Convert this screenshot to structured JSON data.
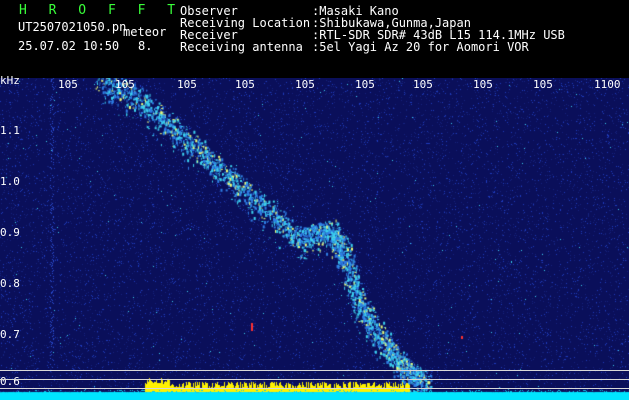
{
  "header": {
    "station": "H R O F F T",
    "filename": "UT2507021050.pn",
    "type": "meteor",
    "datetime": "25.07.02 10:50",
    "count": "8.",
    "observer_label": "Observer",
    "observer_value": ":Masaki Kano",
    "location_label": "Receiving Location",
    "location_value": ":Shibukawa,Gunma,Japan",
    "receiver_label": "Receiver",
    "receiver_value": ":RTL-SDR SDR# 43dB L15 114.1MHz USB",
    "antenna_label": "Receiving antenna",
    "antenna_value": ":5el Yagi Az 20 for Aomori VOR"
  },
  "spectrogram": {
    "y_unit": "kHz",
    "x_ticks": [
      "105",
      "105",
      "105",
      "105",
      "105",
      "105",
      "105",
      "105",
      "105",
      "1100"
    ],
    "y_ticks": [
      "1.1",
      "1.0",
      "0.9",
      "0.8",
      "0.7",
      "0.6"
    ],
    "colors": {
      "background": "#0a0f5a",
      "noise": "#1f3cbe",
      "echo": "#3cd2f0",
      "hot": "#eafc7a",
      "activity_bar": "#fff200",
      "baseline": "#00e5ff",
      "marker_lines": "#d8d8d8"
    }
  }
}
